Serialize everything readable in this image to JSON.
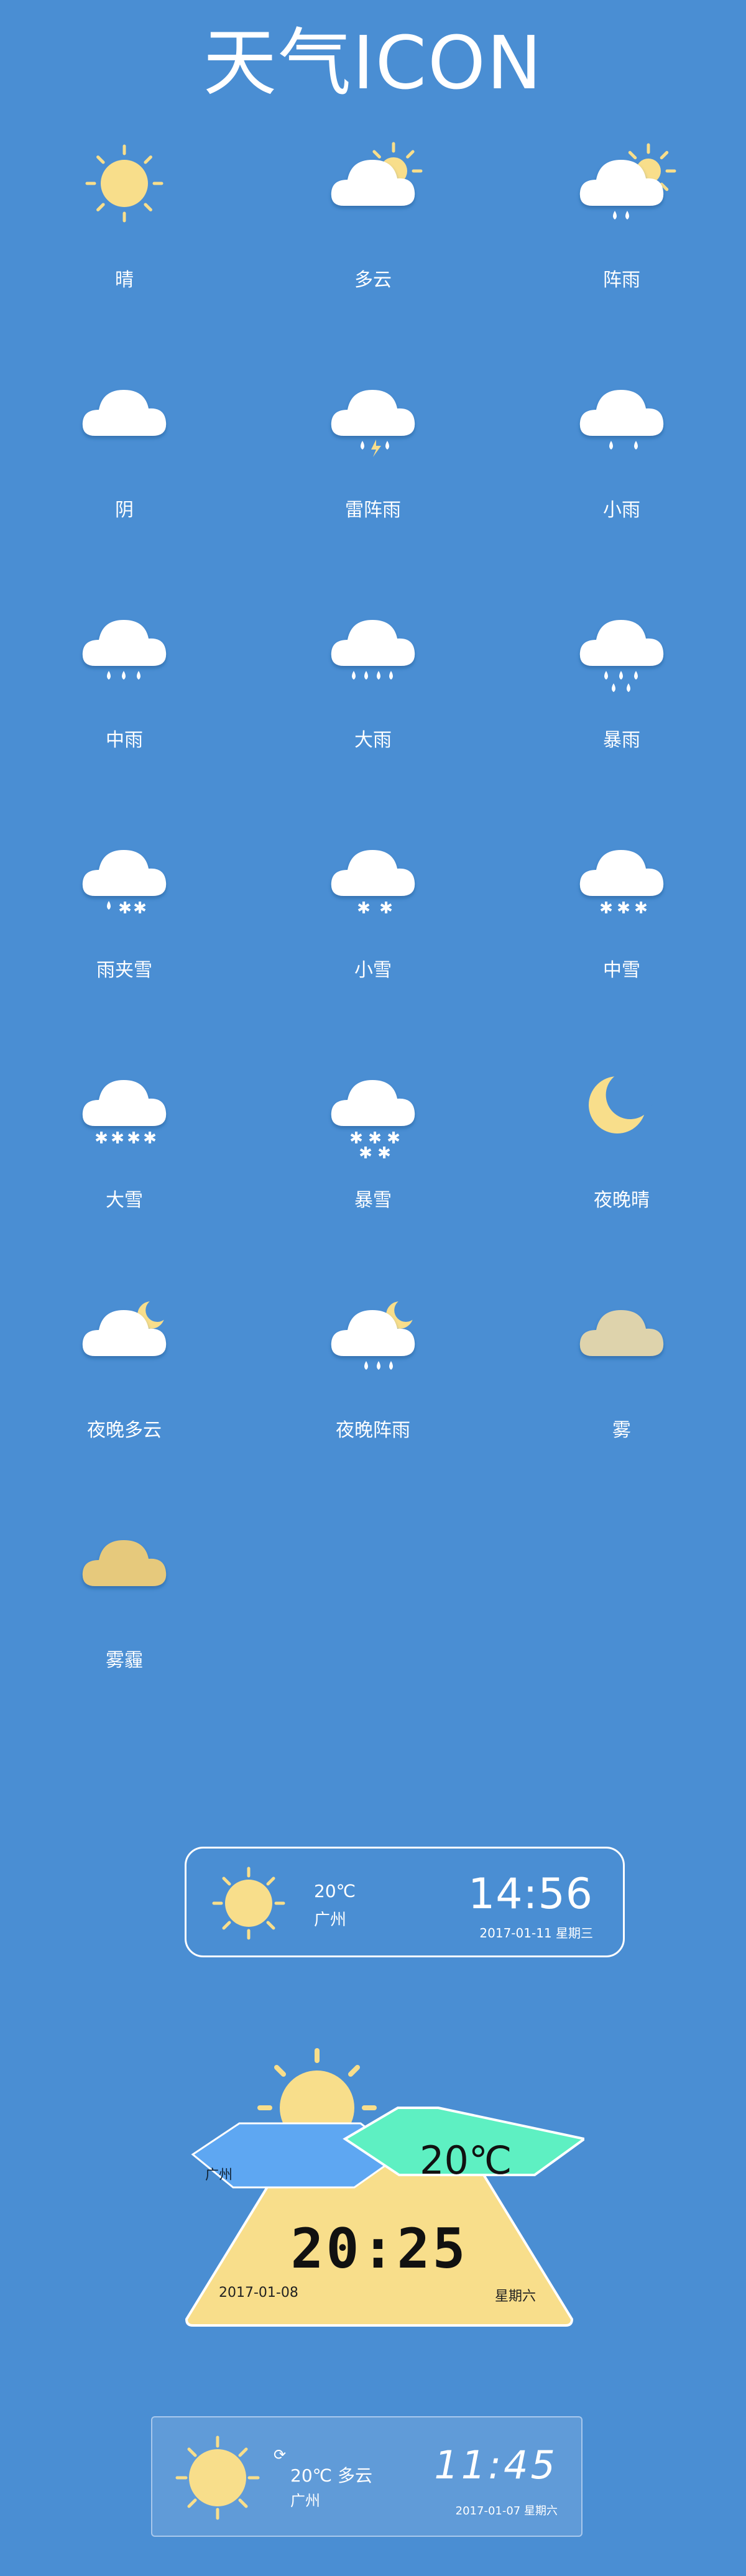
{
  "title": "天气ICON",
  "icons": [
    {
      "label": "晴",
      "icon": "sun-icon"
    },
    {
      "label": "多云",
      "icon": "partly-cloudy-icon"
    },
    {
      "label": "阵雨",
      "icon": "shower-icon"
    },
    {
      "label": "阴",
      "icon": "overcast-icon"
    },
    {
      "label": "雷阵雨",
      "icon": "thunderstorm-icon"
    },
    {
      "label": "小雨",
      "icon": "light-rain-icon"
    },
    {
      "label": "中雨",
      "icon": "moderate-rain-icon"
    },
    {
      "label": "大雨",
      "icon": "heavy-rain-icon"
    },
    {
      "label": "暴雨",
      "icon": "rainstorm-icon"
    },
    {
      "label": "雨夹雪",
      "icon": "sleet-icon"
    },
    {
      "label": "小雪",
      "icon": "light-snow-icon"
    },
    {
      "label": "中雪",
      "icon": "moderate-snow-icon"
    },
    {
      "label": "大雪",
      "icon": "heavy-snow-icon"
    },
    {
      "label": "暴雪",
      "icon": "blizzard-icon"
    },
    {
      "label": "夜晚晴",
      "icon": "clear-night-icon"
    },
    {
      "label": "夜晚多云",
      "icon": "cloudy-night-icon"
    },
    {
      "label": "夜晚阵雨",
      "icon": "night-shower-icon"
    },
    {
      "label": "雾",
      "icon": "fog-icon"
    },
    {
      "label": "雾霾",
      "icon": "haze-icon"
    }
  ],
  "widget1": {
    "temp": "20℃",
    "city": "广州",
    "time": "14:56",
    "date": "2017-01-11 星期三"
  },
  "widget2": {
    "city": "广州",
    "temp": "20℃",
    "time": "20:25",
    "date": "2017-01-08",
    "weekday": "星期六"
  },
  "widget3": {
    "refresh": "⟳",
    "temp": "20℃ 多云",
    "city": "广州",
    "time": "11:45",
    "date": "2017-01-07 星期六"
  },
  "colors": {
    "background": "#4a8ed3",
    "sun": "#f8de8b",
    "cloud": "#ffffff",
    "fog": "#ded3ac",
    "haze": "#e6c97c",
    "mint": "#5ef0c2",
    "sky": "#5ea7f2"
  }
}
